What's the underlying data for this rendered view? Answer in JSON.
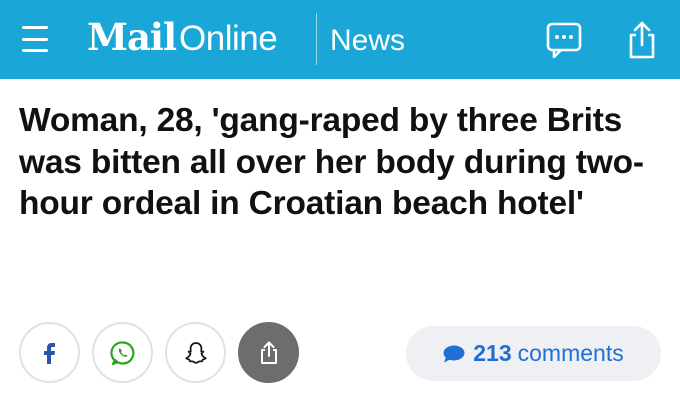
{
  "header": {
    "logo_mail": "Mail",
    "logo_online": "Online",
    "section": "News",
    "bg_color": "#1aa7d7",
    "icons": [
      "menu-icon",
      "comment-bubble-icon",
      "share-icon"
    ]
  },
  "article": {
    "headline": "Woman, 28, 'gang-raped by three Brits was bitten all over her body during two-hour ordeal in Croatian beach hotel'"
  },
  "share_bar": {
    "buttons": [
      "facebook-icon",
      "whatsapp-icon",
      "snapchat-icon",
      "share-icon"
    ]
  },
  "comments": {
    "count": "213",
    "label": "comments",
    "color": "#1f6fd6"
  }
}
